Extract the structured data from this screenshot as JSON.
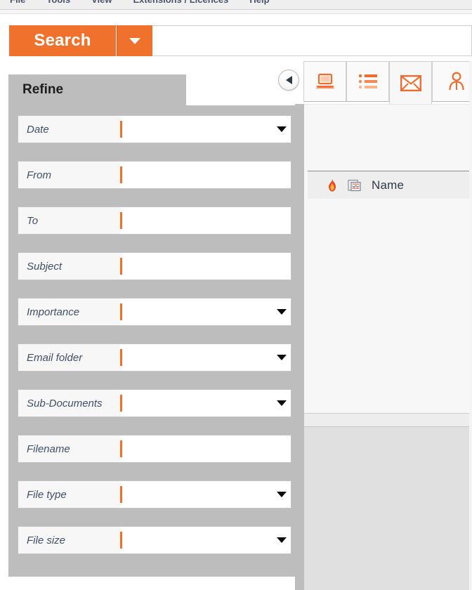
{
  "menubar": {
    "items": [
      {
        "label": "File"
      },
      {
        "label": "Tools"
      },
      {
        "label": "View"
      },
      {
        "label": "Extensions / Licences"
      },
      {
        "label": "Help"
      }
    ]
  },
  "search": {
    "button_label": "Search",
    "dropdown_icon": "caret-down-icon",
    "input_value": "",
    "input_placeholder": ""
  },
  "toolbar": {
    "back_icon": "back-arrow-icon",
    "tabs": [
      {
        "name": "computer",
        "icon": "laptop-icon",
        "active": false
      },
      {
        "name": "list",
        "icon": "list-icon",
        "active": false
      },
      {
        "name": "email",
        "icon": "envelope-icon",
        "active": true
      },
      {
        "name": "contacts",
        "icon": "person-icon",
        "active": false
      }
    ]
  },
  "refine": {
    "tab_label": "Refine",
    "fields": [
      {
        "label": "Date",
        "type": "select",
        "value": ""
      },
      {
        "label": "From",
        "type": "text",
        "value": ""
      },
      {
        "label": "To",
        "type": "text",
        "value": ""
      },
      {
        "label": "Subject",
        "type": "text",
        "value": ""
      },
      {
        "label": "Importance",
        "type": "select",
        "value": ""
      },
      {
        "label": "Email folder",
        "type": "select",
        "value": ""
      },
      {
        "label": "Sub-Documents",
        "type": "select",
        "value": ""
      },
      {
        "label": "Filename",
        "type": "text",
        "value": ""
      },
      {
        "label": "File type",
        "type": "select",
        "value": ""
      },
      {
        "label": "File size",
        "type": "select",
        "value": ""
      }
    ]
  },
  "results": {
    "header": {
      "flame_icon": "flame-icon",
      "document_icon": "document-icon",
      "name_label": "Name"
    },
    "rows": []
  },
  "colors": {
    "accent_orange": "#f0712c",
    "panel_gray": "#bdbdbd",
    "label_text": "#3f5067",
    "content_bg": "#f7f7f7"
  }
}
